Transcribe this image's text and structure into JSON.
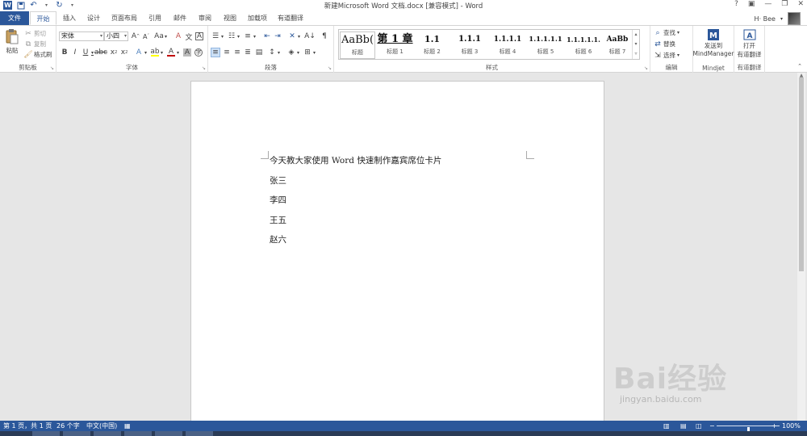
{
  "titlebar": {
    "title": "新建Microsoft Word 文档.docx [兼容模式] - Word",
    "controls": [
      "?",
      "▣",
      "—",
      "❐",
      "✕"
    ]
  },
  "tabs": [
    {
      "label": "文件"
    },
    {
      "label": "开始"
    },
    {
      "label": "插入"
    },
    {
      "label": "设计"
    },
    {
      "label": "页面布局"
    },
    {
      "label": "引用"
    },
    {
      "label": "邮件"
    },
    {
      "label": "审阅"
    },
    {
      "label": "视图"
    },
    {
      "label": "加载项"
    },
    {
      "label": "有道翻译"
    }
  ],
  "user": {
    "name": "H·  Bee"
  },
  "ribbon": {
    "clipboard": {
      "paste": "粘贴",
      "cut": "剪切",
      "copy": "复制",
      "format_painter": "格式刷",
      "label": "剪贴板"
    },
    "font": {
      "font_name": "宋体",
      "font_size": "小四",
      "label": "字体"
    },
    "paragraph": {
      "label": "段落"
    },
    "styles": {
      "label": "样式",
      "items": [
        {
          "preview": "AaBb(",
          "name": "标题"
        },
        {
          "preview": "第 1 章",
          "name": "标题 1"
        },
        {
          "preview": "1.1",
          "name": "标题 2"
        },
        {
          "preview": "1.1.1",
          "name": "标题 3"
        },
        {
          "preview": "1.1.1.1",
          "name": "标题 4"
        },
        {
          "preview": "1.1.1.1.1",
          "name": "标题 5"
        },
        {
          "preview": "1.1.1.1.1.",
          "name": "标题 6"
        },
        {
          "preview": "AaBb",
          "name": "标题 7"
        }
      ]
    },
    "editing": {
      "find": "查找",
      "replace": "替换",
      "select": "选择",
      "label": "编辑"
    },
    "mindjet": {
      "send_line1": "发送到",
      "send_line2": "MindManager",
      "label": "Mindjet"
    },
    "youdao": {
      "open_line1": "打开",
      "open_line2": "有道翻译",
      "label": "有道翻译"
    }
  },
  "document": {
    "lines": [
      "今天教大家使用 Word 快速制作嘉宾席位卡片",
      "张三",
      "李四",
      "王五",
      "赵六"
    ]
  },
  "watermark": {
    "logo": "Bai经验",
    "url": "jingyan.baidu.com"
  },
  "statusbar": {
    "page": "第 1 页，共 1 页",
    "words": "26 个字",
    "language": "中文(中国)",
    "zoom": "100%",
    "zoom_level": 1.0
  },
  "colors": {
    "accent": "#2b579a",
    "status_bg": "#2b579a",
    "canvas_bg": "#e6e6e6"
  }
}
